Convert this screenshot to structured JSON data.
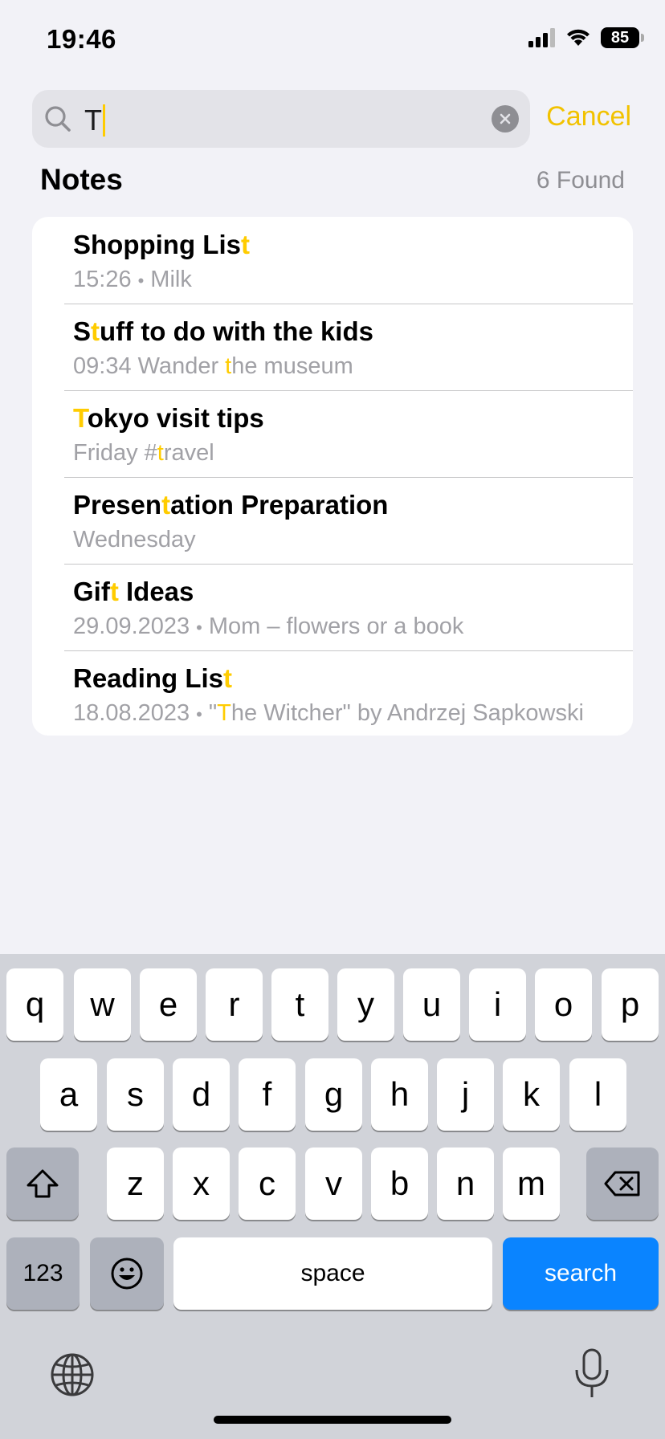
{
  "status_bar": {
    "time": "19:46",
    "battery": "85"
  },
  "search": {
    "value": "T",
    "cancel_label": "Cancel"
  },
  "section": {
    "title": "Notes",
    "found": "6 Found"
  },
  "colors": {
    "accent": "#ffcc00",
    "search_key": "#0a84ff",
    "background": "#f2f2f7"
  },
  "results": [
    {
      "title": [
        "Shopping Lis",
        "t",
        ""
      ],
      "date": "15:26",
      "dot": "•",
      "snippet": [
        "Milk",
        "",
        ""
      ]
    },
    {
      "title": [
        "S",
        "t",
        "uff to do with the kids"
      ],
      "date": "09:34",
      "dot": "",
      "snippet": [
        "Wander ",
        "t",
        "he museum"
      ]
    },
    {
      "title": [
        "",
        "T",
        "okyo visit tips"
      ],
      "date": "Friday",
      "dot": "",
      "snippet": [
        "#",
        "t",
        "ravel"
      ]
    },
    {
      "title": [
        "Presen",
        "t",
        "ation Preparation"
      ],
      "date": "Wednesday",
      "dot": "",
      "snippet": [
        "",
        "",
        ""
      ]
    },
    {
      "title": [
        "Gif",
        "t",
        " Ideas"
      ],
      "date": "29.09.2023",
      "dot": "•",
      "snippet": [
        "Mom – flowers or a book",
        "",
        ""
      ]
    },
    {
      "title": [
        "Reading Lis",
        "t",
        ""
      ],
      "date": "18.08.2023",
      "dot": "•",
      "snippet": [
        "\"",
        "T",
        "he Witcher\" by Andrzej Sapkowski"
      ]
    }
  ],
  "keyboard": {
    "row1": [
      "q",
      "w",
      "e",
      "r",
      "t",
      "y",
      "u",
      "i",
      "o",
      "p"
    ],
    "row2": [
      "a",
      "s",
      "d",
      "f",
      "g",
      "h",
      "j",
      "k",
      "l"
    ],
    "row3": [
      "z",
      "x",
      "c",
      "v",
      "b",
      "n",
      "m"
    ],
    "numbers_label": "123",
    "space_label": "space",
    "search_label": "search",
    "icons": {
      "shift": "shift-icon",
      "delete": "delete-icon",
      "emoji": "emoji-icon",
      "globe": "globe-icon",
      "mic": "microphone-icon"
    }
  }
}
